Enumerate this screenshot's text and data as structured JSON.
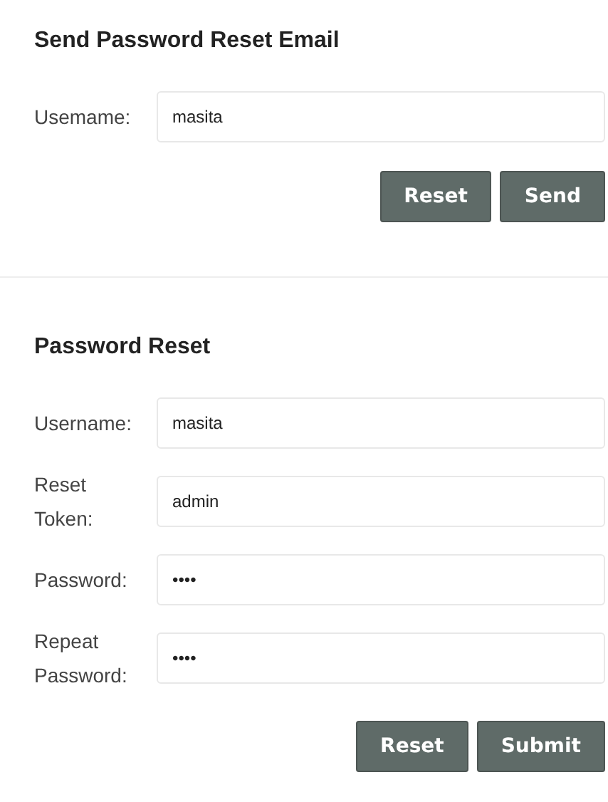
{
  "sections": [
    {
      "title": "Send Password Reset Email",
      "fields": [
        {
          "label": "Usemame:",
          "value": "masita"
        }
      ],
      "buttons": [
        "Reset",
        "Send"
      ]
    },
    {
      "title": "Password Reset",
      "fields": [
        {
          "label": "Username:",
          "value": "masita"
        },
        {
          "label": "Reset Token:",
          "value": "admin"
        },
        {
          "label": "Password:",
          "value": "••••"
        },
        {
          "label": "Repeat Password:",
          "value": "••••"
        }
      ],
      "buttons": [
        "Reset",
        "Submit"
      ]
    }
  ]
}
